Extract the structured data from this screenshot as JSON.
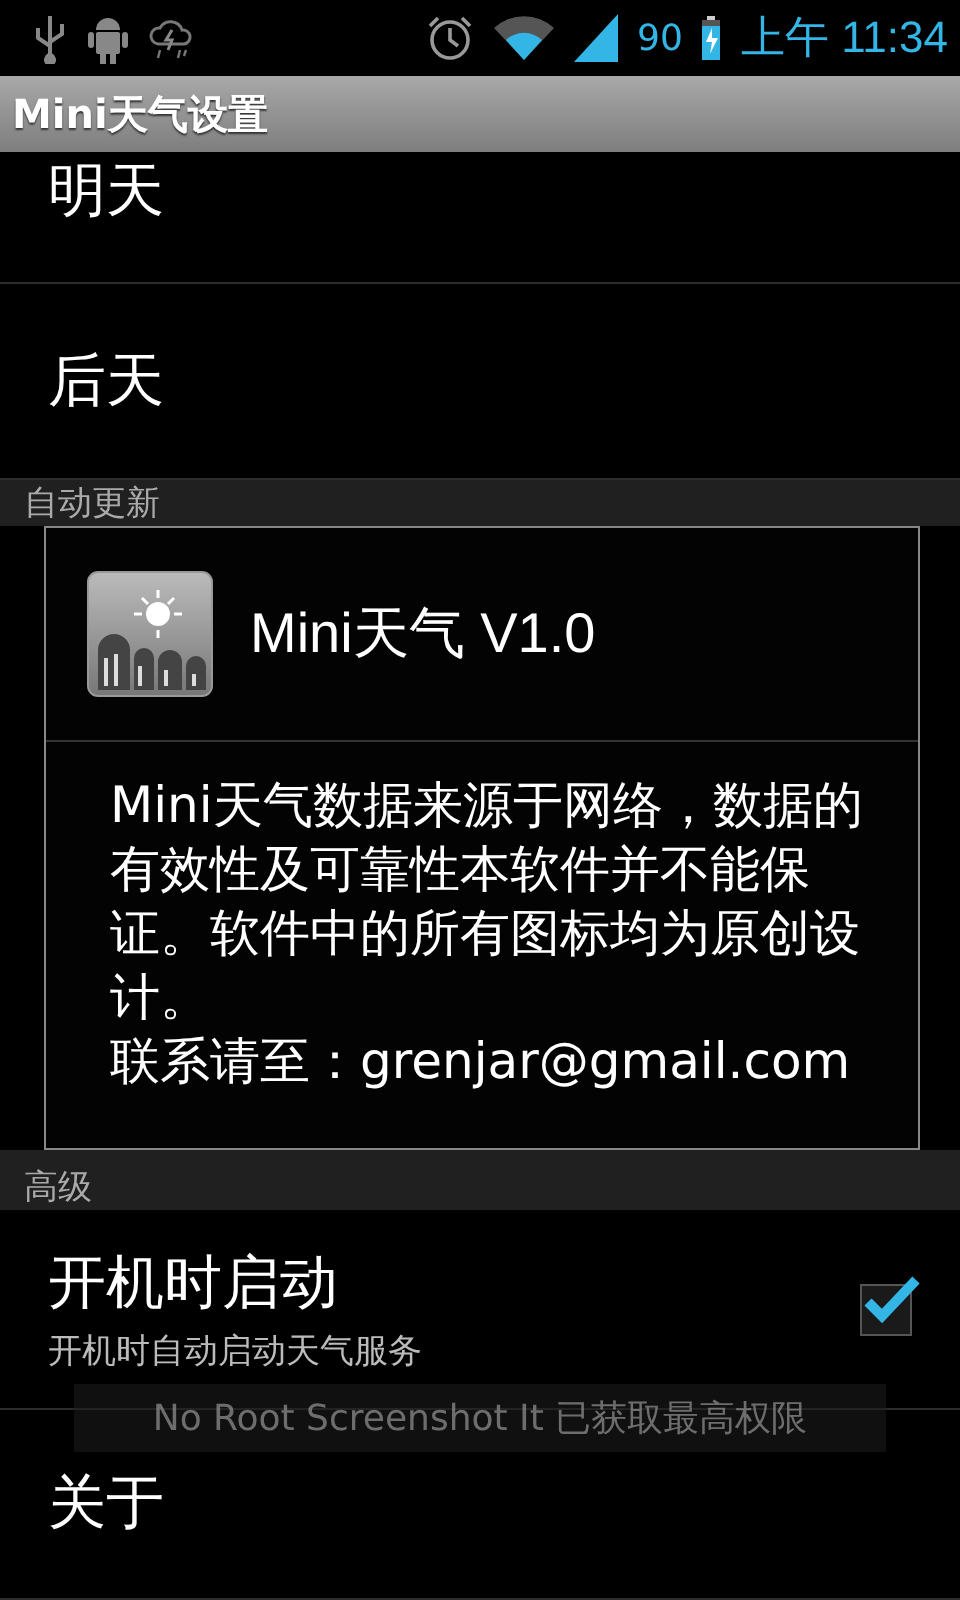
{
  "status_bar": {
    "battery": "90",
    "time": "上午 11:34"
  },
  "title_bar": {
    "title": "Mini天气设置"
  },
  "preferences": [
    {
      "kind": "item",
      "title": "明天"
    },
    {
      "kind": "item",
      "title": "后天"
    },
    {
      "kind": "category",
      "title": "自动更新"
    },
    {
      "kind": "dialog"
    },
    {
      "kind": "category",
      "title": "高级"
    },
    {
      "kind": "checkbox",
      "title": "开机时启动",
      "summary": "开机时自动启动天气服务",
      "checked": true
    },
    {
      "kind": "item",
      "title": "关于"
    }
  ],
  "dialog": {
    "title": "Mini天气 V1.0",
    "message": [
      "Mini天气数据来源于网络，数据的有效性及可靠性本软件并不能保证。软件中的所有图标均为原创设计。",
      "联系请至：grenjar@gmail.com"
    ]
  },
  "toast": {
    "text": "No Root Screenshot It 已获取最高权限"
  }
}
